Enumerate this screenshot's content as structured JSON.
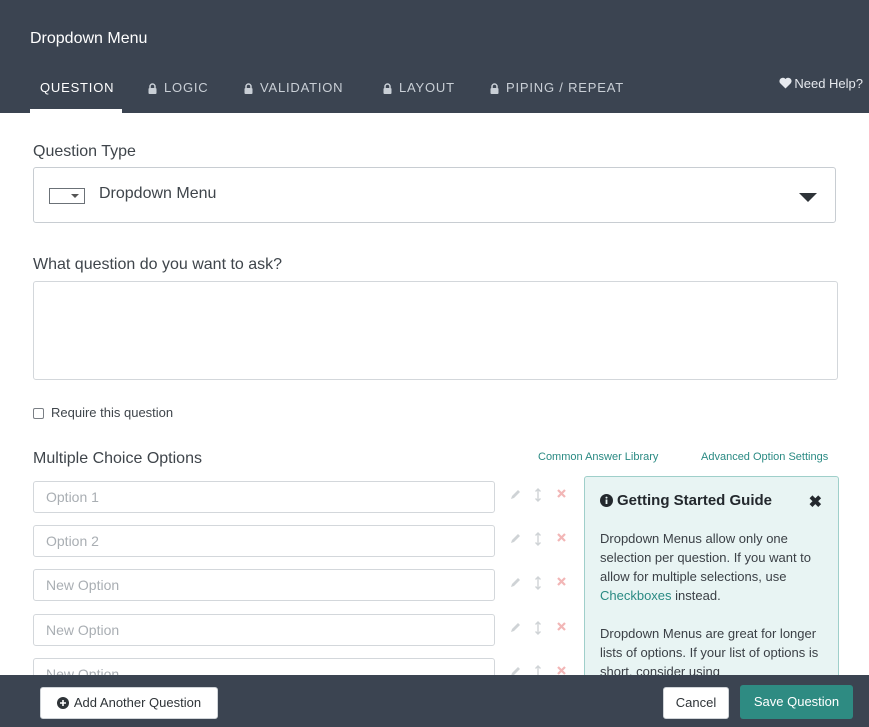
{
  "header": {
    "title": "Dropdown Menu",
    "tabs": [
      {
        "label": "QUESTION",
        "locked": false,
        "active": true
      },
      {
        "label": "LOGIC",
        "locked": true
      },
      {
        "label": "VALIDATION",
        "locked": true
      },
      {
        "label": "LAYOUT",
        "locked": true
      },
      {
        "label": "PIPING / REPEAT",
        "locked": true
      }
    ],
    "help_label": "Need Help?"
  },
  "question_type": {
    "label": "Question Type",
    "selected": "Dropdown Menu"
  },
  "question_text": {
    "label": "What question do you want to ask?",
    "value": ""
  },
  "require": {
    "label": "Require this question",
    "checked": false
  },
  "options": {
    "label": "Multiple Choice Options",
    "common_library_link": "Common Answer Library",
    "advanced_link": "Advanced Option Settings",
    "items": [
      {
        "placeholder": "Option 1"
      },
      {
        "placeholder": "Option 2"
      },
      {
        "placeholder": "New Option"
      },
      {
        "placeholder": "New Option"
      },
      {
        "placeholder": "New Option"
      }
    ]
  },
  "guide": {
    "title": "Getting Started Guide",
    "close": "✖",
    "para1_pre": "Dropdown Menus allow only one selection per question. If you want to allow for multiple selections, use ",
    "para1_link": "Checkboxes",
    "para1_post": " instead.",
    "para2": "Dropdown Menus are great for longer lists of options. If your list of options is short, consider using"
  },
  "footer": {
    "add_label": "Add Another Question",
    "cancel_label": "Cancel",
    "save_label": "Save Question"
  },
  "colors": {
    "header_bg": "#3b4451",
    "accent": "#2e8b82",
    "guide_bg": "#e8f4f3"
  }
}
